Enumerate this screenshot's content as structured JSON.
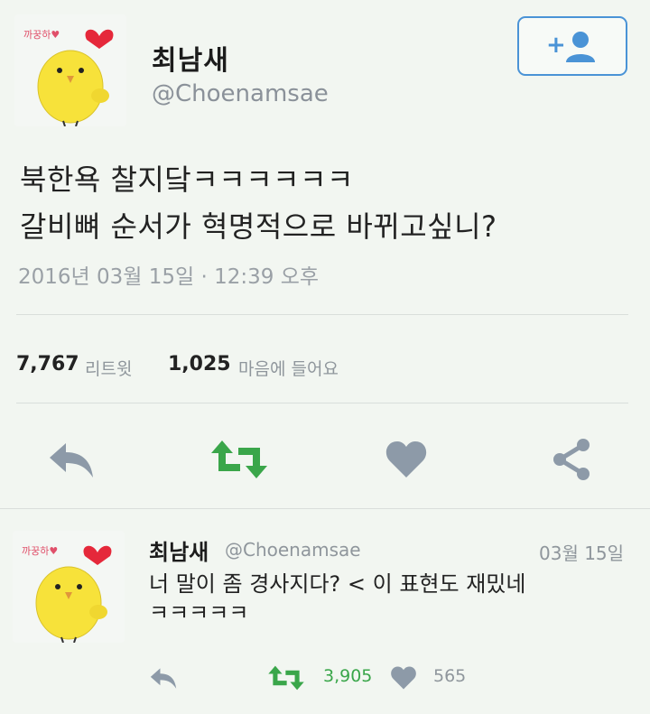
{
  "author": {
    "name": "최남새",
    "handle": "@Choenamsae",
    "avatar_label": "까꿍하♥"
  },
  "tweet": {
    "lines": [
      "북한욕 찰지닼ㅋㅋㅋㅋㅋㅋ",
      "갈비뼈 순서가 혁명적으로 바뀌고싶니?"
    ],
    "timestamp": "2016년 03월 15일 · 12:39 오후",
    "retweet_count": "7,767",
    "retweet_label": "리트윗",
    "like_count": "1,025",
    "like_label": "마음에 들어요"
  },
  "actions": {
    "reply": "reply-icon",
    "retweet": "retweet-icon",
    "like": "heart-icon",
    "share": "share-icon"
  },
  "reply": {
    "name": "최남새",
    "handle": "@Choenamsae",
    "date": "03월 15일",
    "lines": [
      "너 말이 좀 경사지다? < 이 표현도 재밌네",
      "ㅋㅋㅋㅋㅋ"
    ],
    "retweet_count": "3,905",
    "like_count": "565"
  },
  "colors": {
    "background": "#f2f6f1",
    "follow_blue": "#4a93d6",
    "retweet_green": "#3aa64a",
    "icon_gray": "#8d9aa8",
    "chick_yellow": "#f7e23a",
    "heart_red": "#e5283a"
  }
}
